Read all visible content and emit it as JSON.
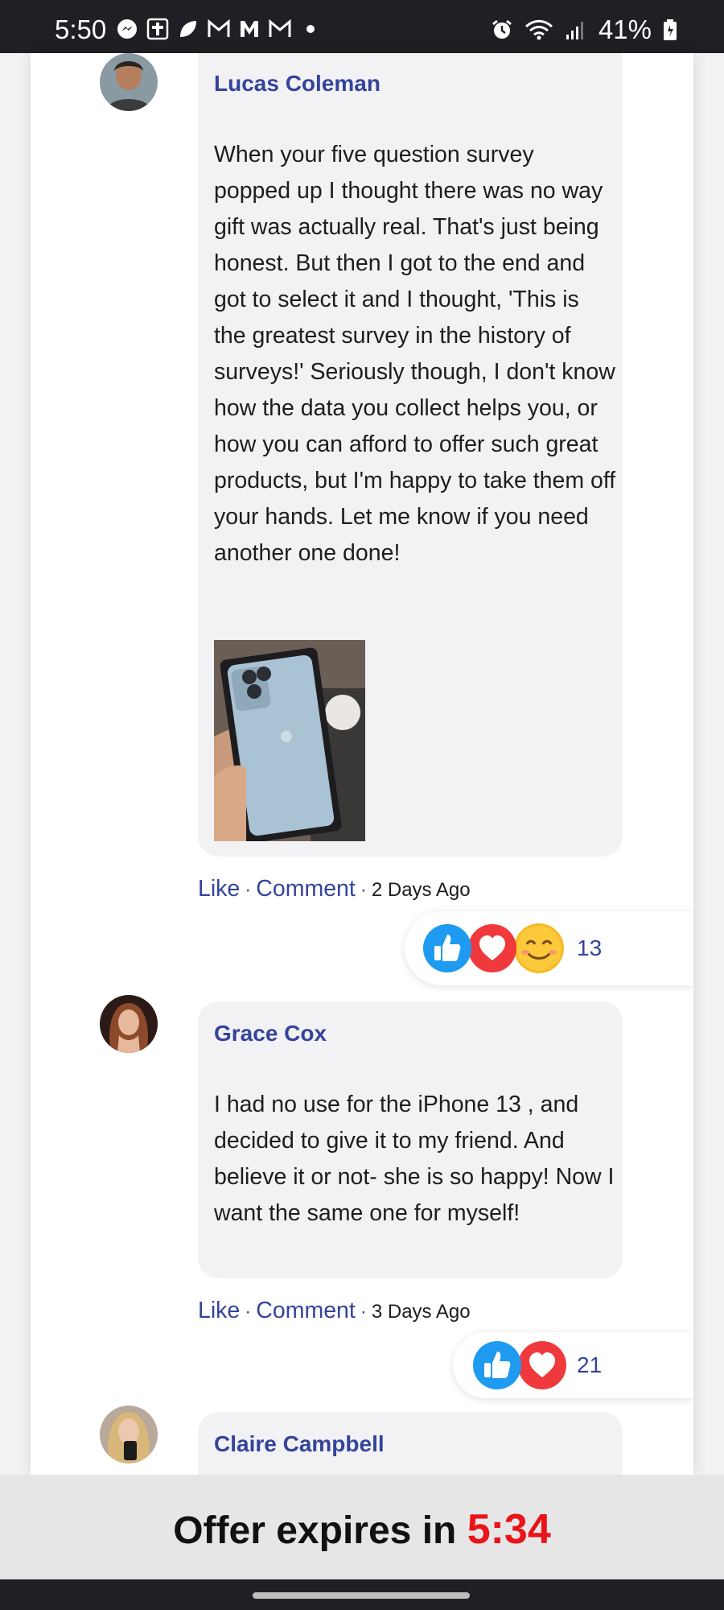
{
  "status_bar": {
    "time": "5:50",
    "left_icons": [
      "messenger-icon",
      "bible-app-icon",
      "leaf-app-icon",
      "gmail-icon",
      "m-app-icon",
      "gmail-icon-2",
      "dot-indicator"
    ],
    "right_icons": [
      "alarm-icon",
      "wifi-icon",
      "signal-icon"
    ],
    "battery": "41%"
  },
  "comments": [
    {
      "author": "Lucas Coleman",
      "text": "When your five question survey popped up I thought there was no way gift was actually real. That's just being honest. But then I got to the end and got to select it and I thought, 'This is the greatest survey in the history of surveys!' Seriously though, I don't know how the data you collect helps you, or how you can afford to offer such great products, but I'm happy to take them off your hands. Let me know if you need another one done!",
      "has_photo": true,
      "like_label": "Like",
      "comment_label": "Comment",
      "time": "2 Days Ago",
      "reactions": [
        "like",
        "love",
        "smile"
      ],
      "reaction_count": "13"
    },
    {
      "author": "Grace Cox",
      "text": "I had no use for the iPhone 13 , and decided to give it to my friend. And believe it or not- she is so happy! Now I want the same one for myself!",
      "has_photo": false,
      "like_label": "Like",
      "comment_label": "Comment",
      "time": "3 Days Ago",
      "reactions": [
        "like",
        "love"
      ],
      "reaction_count": "21"
    },
    {
      "author": "Claire Campbell"
    }
  ],
  "separator": "·",
  "offer": {
    "label": "Offer expires in",
    "timer": "5:34"
  },
  "colors": {
    "link": "#34449a",
    "timer": "#e8141a",
    "like": "#1e9bf0",
    "love": "#f0393c"
  }
}
